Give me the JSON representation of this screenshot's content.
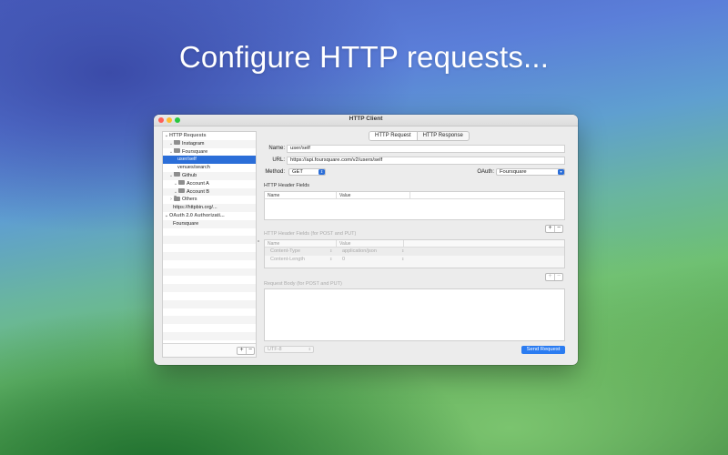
{
  "hero": {
    "title": "Configure HTTP requests..."
  },
  "window": {
    "title": "HTTP Client"
  },
  "sidebar": {
    "rows": [
      {
        "label": "HTTP Requests",
        "indent": 0,
        "chevron": "⌄",
        "folder": false,
        "header": true
      },
      {
        "label": "Instagram",
        "indent": 1,
        "chevron": "⌄",
        "folder": true
      },
      {
        "label": "Foursquare",
        "indent": 1,
        "chevron": "⌄",
        "folder": true
      },
      {
        "label": "user/self",
        "indent": 3,
        "chevron": "",
        "folder": false,
        "selected": true
      },
      {
        "label": "venues/search",
        "indent": 3,
        "chevron": "",
        "folder": false
      },
      {
        "label": "Github",
        "indent": 1,
        "chevron": "⌄",
        "folder": true
      },
      {
        "label": "Account A",
        "indent": 2,
        "chevron": "⌄",
        "folder": true
      },
      {
        "label": "Account B",
        "indent": 2,
        "chevron": "⌄",
        "folder": true
      },
      {
        "label": "Others",
        "indent": 1,
        "chevron": "›",
        "folder": true
      },
      {
        "label": "https://httpbin.org/...",
        "indent": 2,
        "chevron": "",
        "folder": false
      },
      {
        "label": "OAuth 2.0 Authorizati...",
        "indent": 0,
        "chevron": "⌄",
        "folder": false,
        "header": true
      },
      {
        "label": "Foursquare",
        "indent": 2,
        "chevron": "",
        "folder": false
      }
    ],
    "total_rows": 26,
    "add_label": "+",
    "remove_label": "−"
  },
  "tabs": [
    {
      "label": "HTTP Request",
      "active": true
    },
    {
      "label": "HTTP Response",
      "active": false
    }
  ],
  "form": {
    "name_label": "Name:",
    "name_value": "user/self",
    "url_label": "URL:",
    "url_value": "https://api.foursquare.com/v2/users/self",
    "method_label": "Method:",
    "method_value": "GET",
    "oauth_label": "OAuth:",
    "oauth_value": "Foursquare"
  },
  "headers": {
    "title": "HTTP Header Fields",
    "col_name": "Name",
    "col_value": "Value",
    "add_label": "+",
    "remove_label": "−"
  },
  "post_headers": {
    "title": "HTTP Header Fields (for POST and PUT)",
    "col_name": "Name",
    "col_value": "Value",
    "rows": [
      {
        "name": "Content-Type",
        "value": "application/json"
      },
      {
        "name": "Content-Length",
        "value": "0"
      }
    ],
    "add_label": "+",
    "remove_label": "−"
  },
  "body": {
    "title": "Request Body (for POST and PUT)",
    "encoding": "UTF-8",
    "send_label": "Send Request"
  },
  "colors": {
    "accent": "#2b6ed8",
    "send_button": "#2b7cf1",
    "close": "#fe5f57",
    "minimize": "#febc2e",
    "maximize": "#28c840"
  }
}
